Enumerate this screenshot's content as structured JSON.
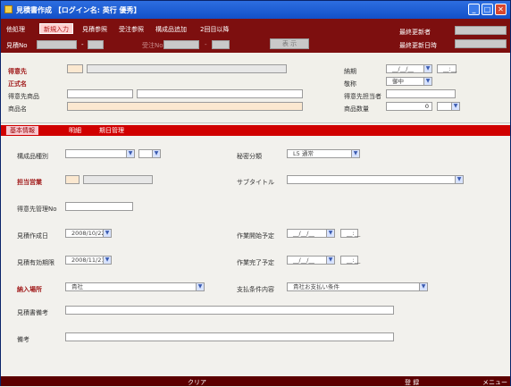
{
  "window": {
    "title": "見積書作成 【ログイン名: 英行 優秀】"
  },
  "menu": {
    "items": [
      "他処理",
      "新規入力",
      "見積参照",
      "受注参照",
      "構成品追加",
      "2回目以降"
    ],
    "active_index": 1
  },
  "header": {
    "estimate_no_label": "見積No",
    "estimate_no_dash": "-",
    "order_no_label": "受注No",
    "order_no_dash": "-",
    "display_button": "表 示",
    "last_updater_label": "最終更新者",
    "last_updated_label": "最終更新日時"
  },
  "form": {
    "customer_label": "得意先",
    "official_name_label": "正式名",
    "customer_product_label": "得意先商品",
    "product_name_label": "商品名",
    "delivery_date_label": "納期",
    "delivery_date_value": "__/__/__",
    "delivery_time_value": "__:__",
    "honorific_label": "敬称",
    "honorific_value": "御中",
    "customer_contact_label": "得意先担当者",
    "product_qty_label": "商品数量",
    "product_qty_value": "0"
  },
  "tabs": [
    "基本情報",
    "明細",
    "期日管理"
  ],
  "details": {
    "component_type_label": "構成品種別",
    "confidential_label": "秘密分類",
    "confidential_value": "L5 通常",
    "sales_rep_label": "担当営業",
    "subtitle_label": "サブタイトル",
    "customer_mgmt_no_label": "得意先管理No",
    "created_date_label": "見積作成日",
    "created_date_value": "2008/10/22",
    "work_start_label": "作業開始予定",
    "work_start_date": "__/__/__",
    "work_start_time": "__:__",
    "valid_until_label": "見積有効期限",
    "valid_until_value": "2008/11/21",
    "work_end_label": "作業完了予定",
    "work_end_date": "__/__/__",
    "work_end_time": "__:__",
    "delivery_place_label": "納入場所",
    "delivery_place_value": "貴社",
    "payment_terms_label": "支払条件内容",
    "payment_terms_value": "貴社お支払い条件",
    "estimate_note_label": "見積書備考",
    "remarks_label": "備考"
  },
  "footer": {
    "left_items": [
      "",
      "",
      ""
    ],
    "clear": "クリア",
    "register": "登 録",
    "menu": "メニュー"
  },
  "colors": {
    "menubar": "#7d0f0f",
    "tabs": "#d00000",
    "title": "#1250c8"
  }
}
